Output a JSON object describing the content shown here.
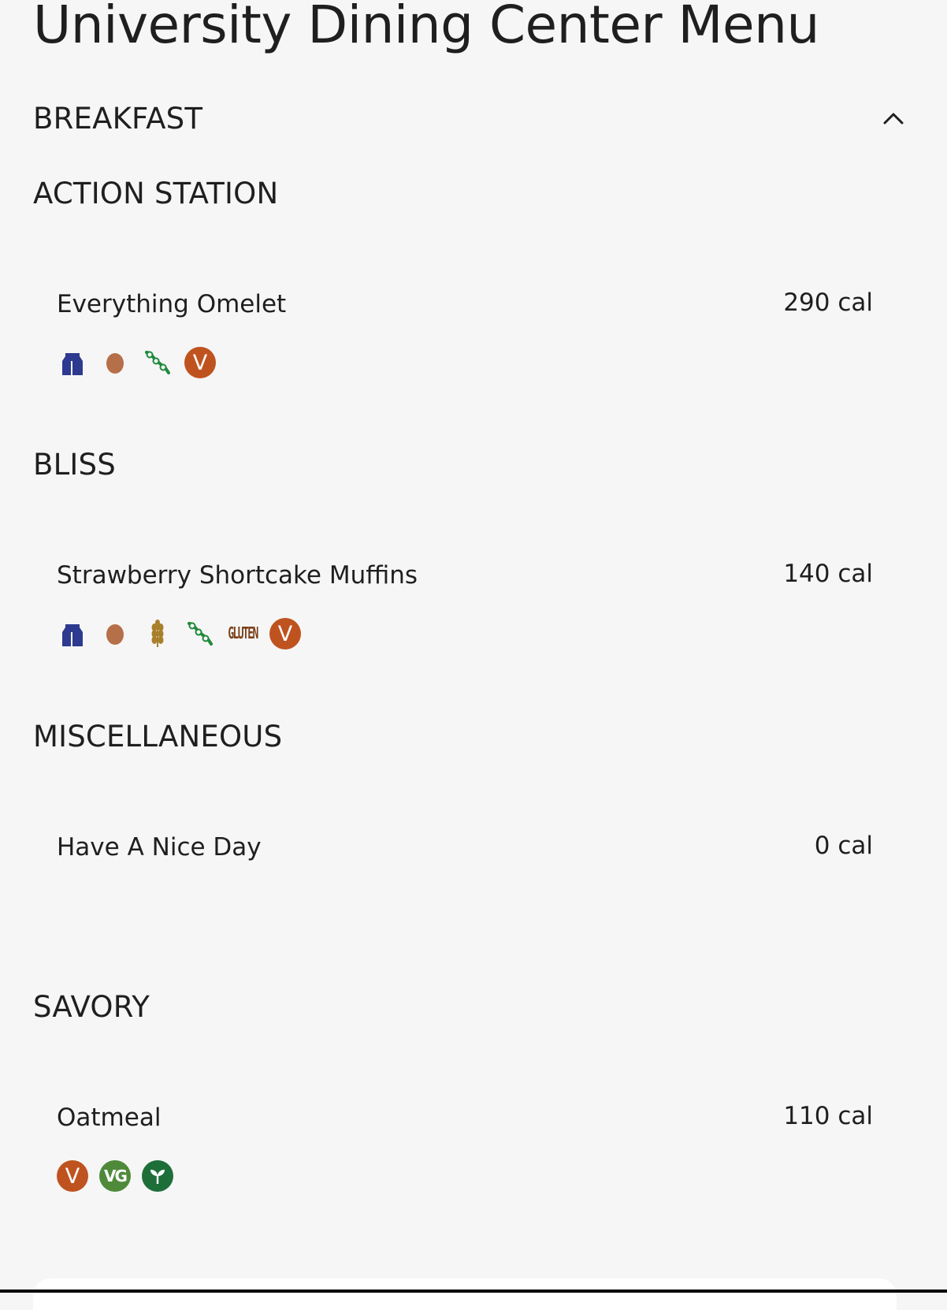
{
  "page": {
    "title": "University Dining Center Menu"
  },
  "meal": {
    "title": "BREAKFAST",
    "toggle_icon": "chevron-up-icon"
  },
  "stations": [
    {
      "title": "ACTION STATION",
      "items": [
        {
          "name": "Everything Omelet",
          "calories": "290 cal",
          "icons": [
            "milk-icon",
            "egg-icon",
            "soy-icon",
            "vegetarian-icon"
          ]
        }
      ]
    },
    {
      "title": "BLISS",
      "items": [
        {
          "name": "Strawberry Shortcake Muffins",
          "calories": "140 cal",
          "icons": [
            "milk-icon",
            "egg-icon",
            "wheat-icon",
            "soy-icon",
            "gluten-icon",
            "vegetarian-icon"
          ]
        }
      ]
    },
    {
      "title": "MISCELLANEOUS",
      "items": [
        {
          "name": "Have A Nice Day",
          "calories": "0 cal",
          "icons": []
        }
      ]
    },
    {
      "title": "SAVORY",
      "items": [
        {
          "name": "Oatmeal",
          "calories": "110 cal",
          "icons": [
            "vegetarian-icon",
            "vegan-icon",
            "plant-based-icon"
          ]
        }
      ]
    }
  ],
  "icon_labels": {
    "vegetarian": "V",
    "vegan": "VG",
    "gluten": "GLUTEN"
  },
  "colors": {
    "background": "#f6f6f6",
    "vegetarian": "#bf5320",
    "vegan": "#4e8a3a",
    "plant_based": "#1e6e3a",
    "milk": "#2e3a8f",
    "egg": "#b5704a",
    "soy": "#1f8a3c",
    "wheat": "#a8802c"
  }
}
